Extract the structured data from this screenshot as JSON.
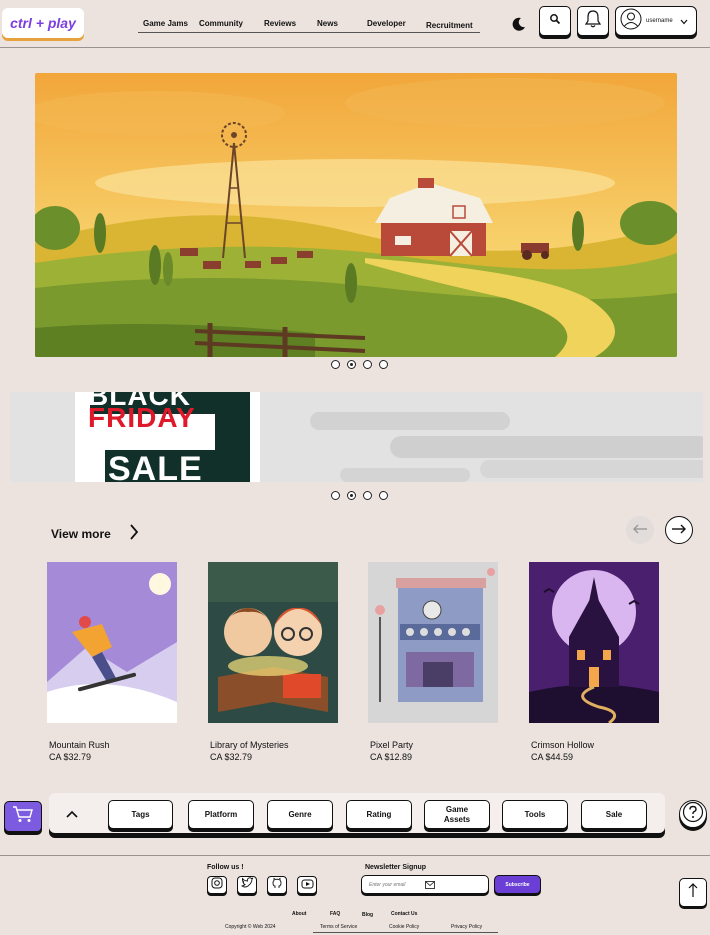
{
  "brand": {
    "logo": "ctrl + play"
  },
  "nav": {
    "items": [
      {
        "label": "Game Jams"
      },
      {
        "label": "Community"
      },
      {
        "label": "Reviews"
      },
      {
        "label": "News"
      },
      {
        "label": "Developer"
      },
      {
        "label": "Recruitment"
      }
    ]
  },
  "header": {
    "theme_icon": "moon-icon",
    "search_icon": "search-icon",
    "notifications_icon": "bell-icon",
    "username": "username",
    "user_dropdown_icon": "chevron-down-icon"
  },
  "hero": {
    "slide_count": 4,
    "active_slide": 2
  },
  "promo": {
    "line0": "BLACK",
    "line1": "FRIDAY",
    "line2": "SALE",
    "slide_count": 4,
    "active_slide": 2
  },
  "products": {
    "view_more": "View more",
    "items": [
      {
        "title": "Mountain Rush",
        "price": "CA $32.79"
      },
      {
        "title": "Library of Mysteries",
        "price": "CA $32.79"
      },
      {
        "title": "Pixel Party",
        "price": "CA $12.89"
      },
      {
        "title": "Crimson Hollow",
        "price": "CA $44.59"
      }
    ]
  },
  "filters": {
    "items": [
      {
        "label": "Tags"
      },
      {
        "label": "Platform"
      },
      {
        "label": "Genre"
      },
      {
        "label": "Rating"
      },
      {
        "label": "Game Assets"
      },
      {
        "label": "Tools"
      },
      {
        "label": "Sale"
      }
    ]
  },
  "footer": {
    "follow_label": "Follow us !",
    "newsletter_label": "Newsletter Signup",
    "email_placeholder": "Enter your email",
    "subscribe_label": "Subscribe",
    "links": [
      {
        "label": "About"
      },
      {
        "label": "FAQ"
      },
      {
        "label": "Blog"
      },
      {
        "label": "Contact Us"
      }
    ],
    "copyright": "Copyright  ©  Web 2024",
    "legal": [
      {
        "label": "Terms of Service"
      },
      {
        "label": "Cookie Policy"
      },
      {
        "label": "Privacy Policy"
      }
    ]
  },
  "colors": {
    "background": "#ece3df",
    "brand_purple": "#7b3fe0",
    "logo_shadow": "#e8a23d",
    "subscribe": "#6b3fd6"
  }
}
